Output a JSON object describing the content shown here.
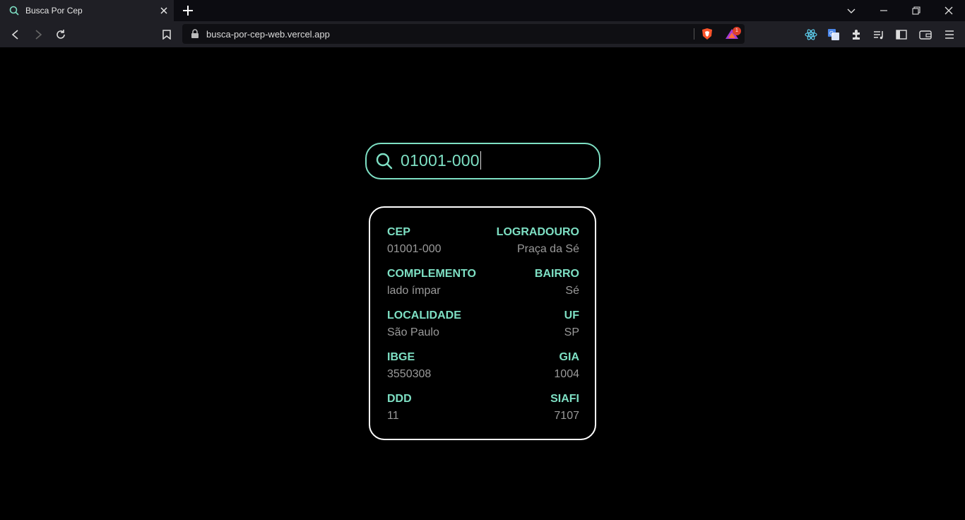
{
  "browser": {
    "tab_title": "Busca Por Cep",
    "url": "busca-por-cep-web.vercel.app",
    "rewards_badge": "1"
  },
  "search": {
    "value": "01001-000"
  },
  "result": {
    "rows": [
      {
        "left": {
          "label": "CEP",
          "value": "01001-000"
        },
        "right": {
          "label": "LOGRADOURO",
          "value": "Praça da Sé"
        }
      },
      {
        "left": {
          "label": "COMPLEMENTO",
          "value": "lado ímpar"
        },
        "right": {
          "label": "BAIRRO",
          "value": "Sé"
        }
      },
      {
        "left": {
          "label": "LOCALIDADE",
          "value": "São Paulo"
        },
        "right": {
          "label": "UF",
          "value": "SP"
        }
      },
      {
        "left": {
          "label": "IBGE",
          "value": "3550308"
        },
        "right": {
          "label": "GIA",
          "value": "1004"
        }
      },
      {
        "left": {
          "label": "DDD",
          "value": "11"
        },
        "right": {
          "label": "SIAFI",
          "value": "7107"
        }
      }
    ]
  },
  "colors": {
    "accent": "#7ee0c4",
    "value_text": "#9a9a9a",
    "background": "#000000"
  }
}
